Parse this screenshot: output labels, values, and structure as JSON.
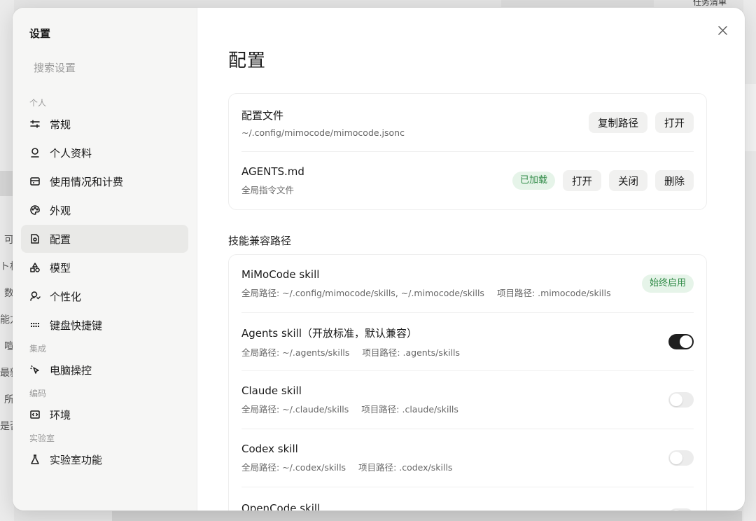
{
  "background": {
    "left_fragments": [
      "可",
      "ト格",
      "数",
      "能方",
      "喧",
      "最新",
      "所",
      "是否"
    ],
    "top_right_text": "任务清单"
  },
  "sidebar": {
    "title": "设置",
    "search_placeholder": "搜索设置",
    "sections": [
      {
        "label": "个人",
        "items": [
          {
            "label": "常规",
            "icon": "sliders-icon",
            "active": false
          },
          {
            "label": "个人资料",
            "icon": "user-icon",
            "active": false
          },
          {
            "label": "使用情况和计费",
            "icon": "billing-icon",
            "active": false
          },
          {
            "label": "外观",
            "icon": "palette-icon",
            "active": false
          },
          {
            "label": "配置",
            "icon": "config-file-icon",
            "active": true
          },
          {
            "label": "模型",
            "icon": "shapes-icon",
            "active": false
          },
          {
            "label": "个性化",
            "icon": "user-personalize-icon",
            "active": false
          },
          {
            "label": "键盘快捷键",
            "icon": "keyboard-icon",
            "active": false
          }
        ]
      },
      {
        "label": "集成",
        "items": [
          {
            "label": "电脑操控",
            "icon": "pointer-icon",
            "active": false
          }
        ]
      },
      {
        "label": "编码",
        "items": [
          {
            "label": "环境",
            "icon": "code-window-icon",
            "active": false
          }
        ]
      },
      {
        "label": "实验室",
        "items": [
          {
            "label": "实验室功能",
            "icon": "flask-icon",
            "active": false
          }
        ]
      }
    ]
  },
  "main": {
    "title": "配置",
    "config_rows": [
      {
        "title": "配置文件",
        "subtitle": "~/.config/mimocode/mimocode.jsonc",
        "badge": "",
        "buttons": [
          "复制路径",
          "打开"
        ]
      },
      {
        "title": "AGENTS.md",
        "subtitle": "全局指令文件",
        "badge": "已加载",
        "buttons": [
          "打开",
          "关闭",
          "删除"
        ]
      }
    ],
    "skills_heading": "技能兼容路径",
    "skills": [
      {
        "title": "MiMoCode skill",
        "global_path": "全局路径: ~/.config/mimocode/skills, ~/.mimocode/skills",
        "project_path": "项目路径: .mimocode/skills",
        "badge": "始终启用",
        "toggle": null
      },
      {
        "title": "Agents skill（开放标准，默认兼容）",
        "global_path": "全局路径: ~/.agents/skills",
        "project_path": "项目路径: .agents/skills",
        "badge": "",
        "toggle": true
      },
      {
        "title": "Claude skill",
        "global_path": "全局路径: ~/.claude/skills",
        "project_path": "项目路径: .claude/skills",
        "badge": "",
        "toggle": false
      },
      {
        "title": "Codex skill",
        "global_path": "全局路径: ~/.codex/skills",
        "project_path": "项目路径: .codex/skills",
        "badge": "",
        "toggle": false
      },
      {
        "title": "OpenCode skill",
        "global_path": "",
        "project_path": "",
        "badge": "",
        "toggle": false
      }
    ]
  },
  "colors": {
    "accent_green_text": "#2f8a46",
    "accent_green_bg": "#e6f4e9",
    "toggle_on": "#1f1f1f",
    "toggle_off": "#ececec"
  }
}
